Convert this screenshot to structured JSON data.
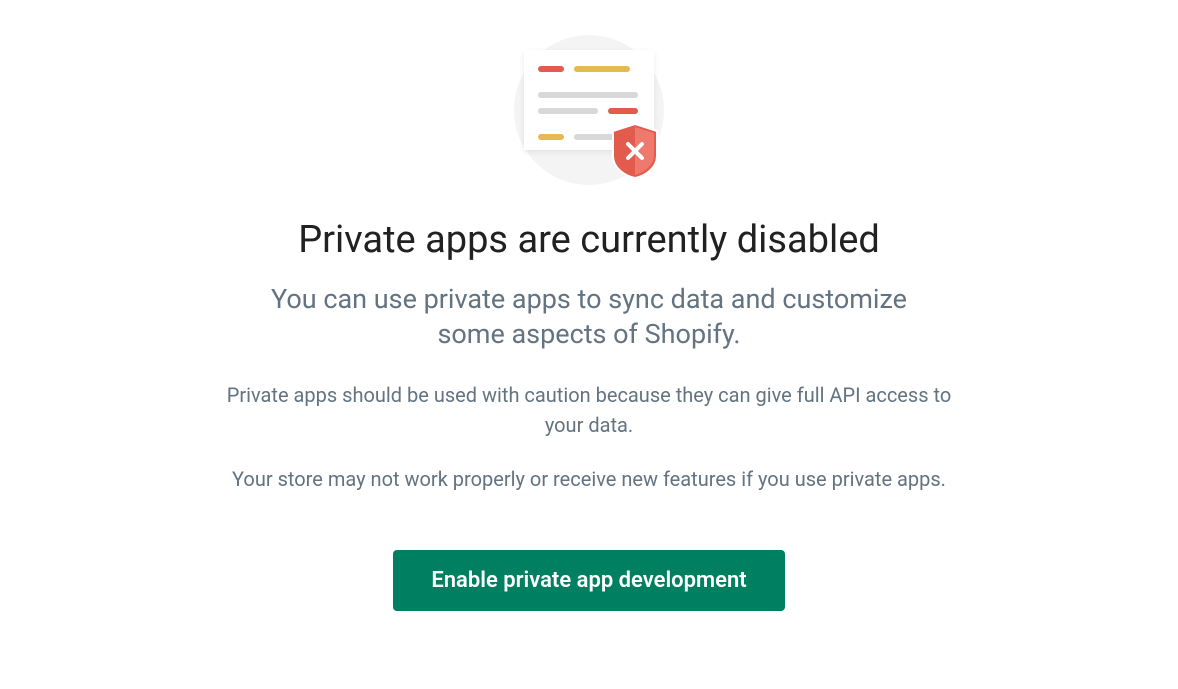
{
  "page": {
    "heading": "Private apps are currently disabled",
    "subheading": "You can use private apps to sync data and customize some aspects of Shopify.",
    "caution_text": "Private apps should be used with caution because they can give full API access to your data.",
    "warning_text": "Your store may not work properly or receive new features if you use private apps.",
    "cta_label": "Enable private app development"
  }
}
